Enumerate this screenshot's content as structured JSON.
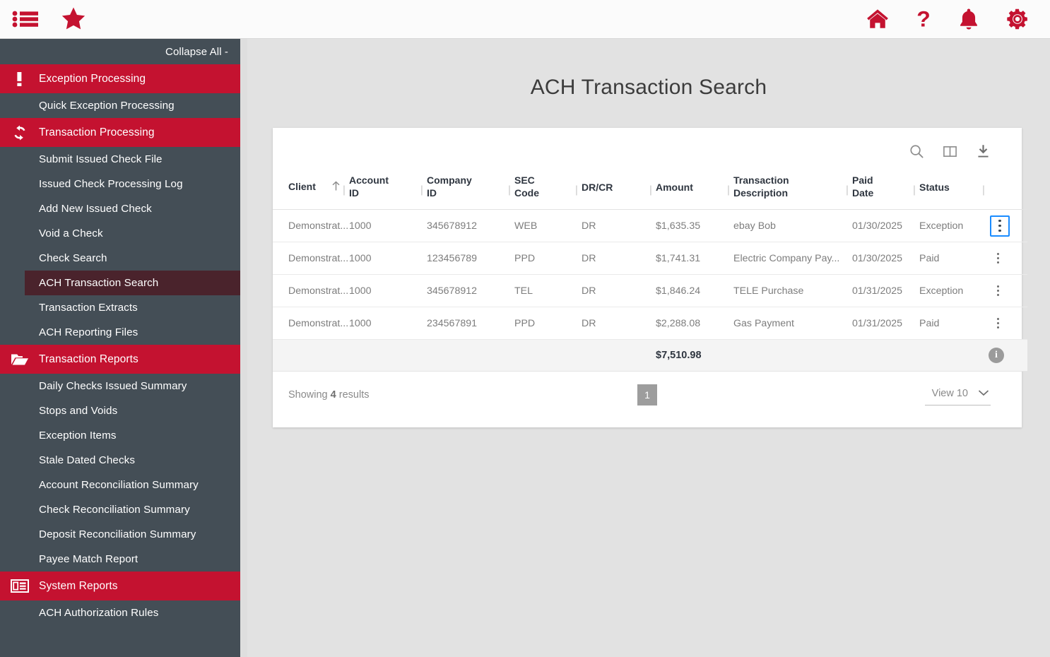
{
  "topbar": {
    "menu_icon": "list-menu-icon",
    "favorites_icon": "star-icon",
    "home_icon": "home-icon",
    "help_icon": "question-mark-icon",
    "notifications_icon": "bell-icon",
    "settings_icon": "gear-icon",
    "accent_color": "#c41230"
  },
  "sidebar": {
    "collapse_all_label": "Collapse All -",
    "bg_color": "#444e56",
    "group_color": "#c41230",
    "active_color": "#4a232c",
    "sections": [
      {
        "label": "Exception Processing",
        "icon": "exclamation-icon",
        "items": [
          {
            "label": "Quick Exception Processing",
            "active": false
          }
        ]
      },
      {
        "label": "Transaction Processing",
        "icon": "refresh-icon",
        "items": [
          {
            "label": "Submit Issued Check File",
            "active": false
          },
          {
            "label": "Issued Check Processing Log",
            "active": false
          },
          {
            "label": "Add New Issued Check",
            "active": false
          },
          {
            "label": "Void a Check",
            "active": false
          },
          {
            "label": "Check Search",
            "active": false
          },
          {
            "label": "ACH Transaction Search",
            "active": true
          },
          {
            "label": "Transaction Extracts",
            "active": false
          },
          {
            "label": "ACH Reporting Files",
            "active": false
          }
        ]
      },
      {
        "label": "Transaction Reports",
        "icon": "folder-open-icon",
        "items": [
          {
            "label": "Daily Checks Issued Summary",
            "active": false
          },
          {
            "label": "Stops and Voids",
            "active": false
          },
          {
            "label": "Exception Items",
            "active": false
          },
          {
            "label": "Stale Dated Checks",
            "active": false
          },
          {
            "label": "Account Reconciliation Summary",
            "active": false
          },
          {
            "label": "Check Reconciliation Summary",
            "active": false
          },
          {
            "label": "Deposit Reconciliation Summary",
            "active": false
          },
          {
            "label": "Payee Match Report",
            "active": false
          }
        ]
      },
      {
        "label": "System Reports",
        "icon": "newspaper-icon",
        "items": [
          {
            "label": "ACH Authorization Rules",
            "active": false
          }
        ]
      }
    ]
  },
  "main": {
    "page_title": "ACH Transaction Search",
    "toolbar": {
      "search_icon": "search-icon",
      "columns_icon": "columns-icon",
      "download_icon": "download-icon"
    },
    "table": {
      "sort_column": "Client",
      "sort_direction": "ascending",
      "columns": [
        {
          "label": "Client",
          "line1": "Client",
          "line2": ""
        },
        {
          "label": "Account ID",
          "line1": "Account",
          "line2": "ID"
        },
        {
          "label": "Company ID",
          "line1": "Company",
          "line2": "ID"
        },
        {
          "label": "SEC Code",
          "line1": "SEC",
          "line2": "Code"
        },
        {
          "label": "DR/CR",
          "line1": "DR/CR",
          "line2": ""
        },
        {
          "label": "Amount",
          "line1": "Amount",
          "line2": ""
        },
        {
          "label": "Transaction Description",
          "line1": "Transaction",
          "line2": "Description"
        },
        {
          "label": "Paid Date",
          "line1": "Paid",
          "line2": "Date"
        },
        {
          "label": "Status",
          "line1": "Status",
          "line2": ""
        }
      ],
      "rows": [
        {
          "client": "Demonstrat...",
          "account_id": "1000",
          "company_id": "345678912",
          "sec_code": "WEB",
          "dr_cr": "DR",
          "amount": "$1,635.35",
          "description": "ebay Bob",
          "paid_date": "01/30/2025",
          "status": "Exception",
          "menu_focused": true
        },
        {
          "client": "Demonstrat...",
          "account_id": "1000",
          "company_id": "123456789",
          "sec_code": "PPD",
          "dr_cr": "DR",
          "amount": "$1,741.31",
          "description": "Electric Company Pay...",
          "paid_date": "01/30/2025",
          "status": "Paid",
          "menu_focused": false
        },
        {
          "client": "Demonstrat...",
          "account_id": "1000",
          "company_id": "345678912",
          "sec_code": "TEL",
          "dr_cr": "DR",
          "amount": "$1,846.24",
          "description": "TELE Purchase",
          "paid_date": "01/31/2025",
          "status": "Exception",
          "menu_focused": false
        },
        {
          "client": "Demonstrat...",
          "account_id": "1000",
          "company_id": "234567891",
          "sec_code": "PPD",
          "dr_cr": "DR",
          "amount": "$2,288.08",
          "description": "Gas Payment",
          "paid_date": "01/31/2025",
          "status": "Paid",
          "menu_focused": false
        }
      ],
      "total": "$7,510.98",
      "total_info_icon": "info-icon"
    },
    "footer": {
      "showing_prefix": "Showing ",
      "showing_count": "4",
      "showing_suffix": " results",
      "current_page": "1",
      "view_label": "View 10",
      "view_chevron_icon": "chevron-down-icon"
    }
  }
}
